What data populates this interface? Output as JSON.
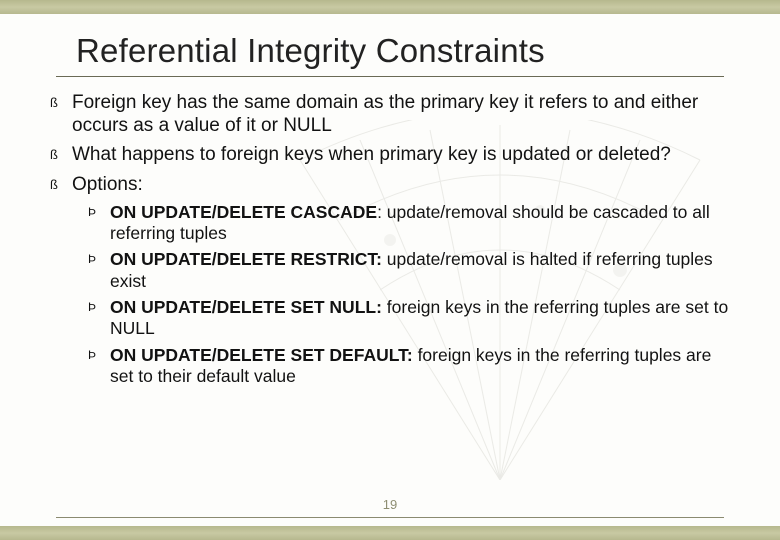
{
  "title": "Referential Integrity Constraints",
  "page_number": "19",
  "bullets": {
    "level1_marker": "ß",
    "level2_marker": "Þ",
    "items": [
      {
        "text": "Foreign key has the same domain as the primary key it refers to and either occurs as a value of it or NULL"
      },
      {
        "text": "What happens to foreign keys when primary key is updated or deleted?"
      },
      {
        "text": "Options:"
      }
    ],
    "sub_items": [
      {
        "bold_prefix": "ON UPDATE/DELETE CASCADE",
        "rest": ": update/removal should be cascaded to all referring tuples"
      },
      {
        "bold_prefix": "ON UPDATE/DELETE RESTRICT:",
        "rest": " update/removal is halted if referring tuples exist"
      },
      {
        "bold_prefix": "ON  UPDATE/DELETE SET NULL:",
        "rest": " foreign keys in the referring tuples are set to NULL"
      },
      {
        "bold_prefix": "ON UPDATE/DELETE SET DEFAULT:",
        "rest": " foreign keys in the referring tuples are set to their default value"
      }
    ]
  }
}
